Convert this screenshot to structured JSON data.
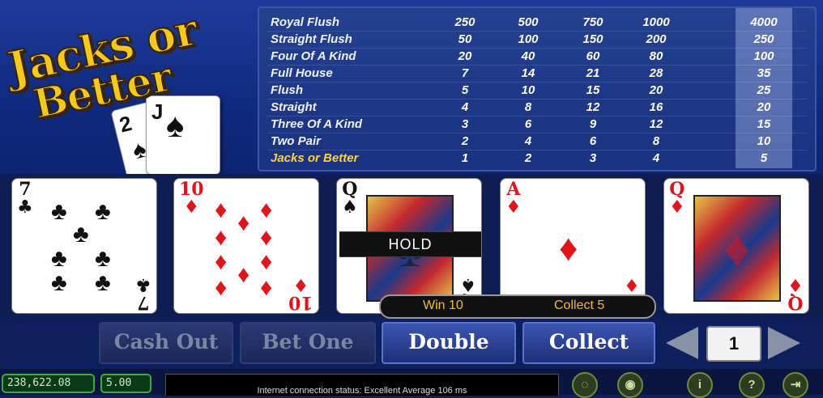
{
  "logo": {
    "line1": "Jacks or",
    "line2": "Better",
    "card1": "2",
    "card2": "J",
    "suit": "♠"
  },
  "paytable": {
    "rows": [
      {
        "hand": "Royal Flush",
        "values": [
          "250",
          "500",
          "750",
          "1000",
          "4000"
        ]
      },
      {
        "hand": "Straight Flush",
        "values": [
          "50",
          "100",
          "150",
          "200",
          "250"
        ]
      },
      {
        "hand": "Four Of A Kind",
        "values": [
          "20",
          "40",
          "60",
          "80",
          "100"
        ]
      },
      {
        "hand": "Full House",
        "values": [
          "7",
          "14",
          "21",
          "28",
          "35"
        ]
      },
      {
        "hand": "Flush",
        "values": [
          "5",
          "10",
          "15",
          "20",
          "25"
        ]
      },
      {
        "hand": "Straight",
        "values": [
          "4",
          "8",
          "12",
          "16",
          "20"
        ]
      },
      {
        "hand": "Three Of A Kind",
        "values": [
          "3",
          "6",
          "9",
          "12",
          "15"
        ]
      },
      {
        "hand": "Two Pair",
        "values": [
          "2",
          "4",
          "6",
          "8",
          "10"
        ]
      },
      {
        "hand": "Jacks or Better",
        "values": [
          "1",
          "2",
          "3",
          "4",
          "5"
        ]
      }
    ],
    "highlight_color": "#ffd23a"
  },
  "cards": [
    {
      "rank": "7",
      "suit": "♣",
      "color": "black"
    },
    {
      "rank": "10",
      "suit": "♦",
      "color": "red"
    },
    {
      "rank": "Q",
      "suit": "♠",
      "color": "black",
      "held": true
    },
    {
      "rank": "A",
      "suit": "♦",
      "color": "red"
    },
    {
      "rank": "Q",
      "suit": "♦",
      "color": "red"
    }
  ],
  "hold_label": "HOLD",
  "message": {
    "win": "Win 10",
    "collect": "Collect 5"
  },
  "buttons": {
    "cash_out": "Cash Out",
    "bet_one": "Bet One",
    "double": "Double",
    "collect": "Collect"
  },
  "bet": {
    "value": "1"
  },
  "status": {
    "balance": "238,622.08",
    "bet_amount": "5.00",
    "connection": "Internet connection status:    Excellent   Average 106 ms"
  },
  "icons": [
    "sound-off-icon",
    "sound-icon",
    "info-icon",
    "help-icon",
    "exit-icon"
  ]
}
